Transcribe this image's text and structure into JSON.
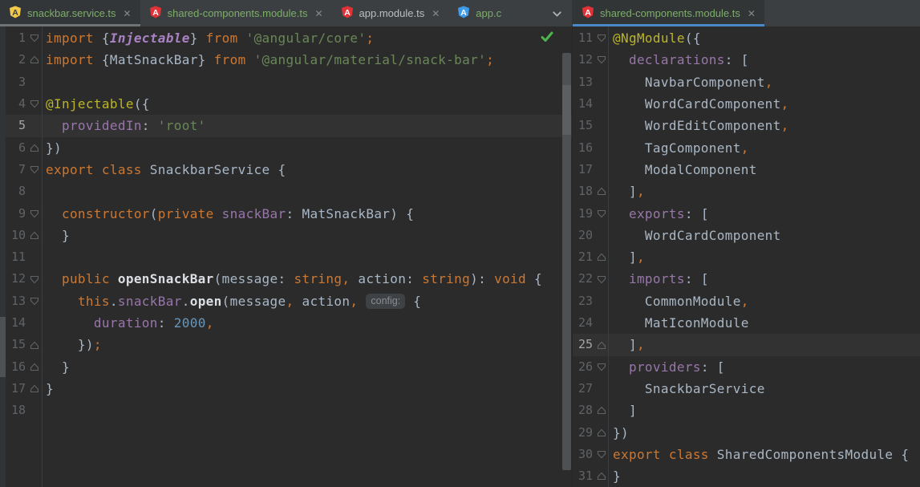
{
  "colors": {
    "active_tab_underline": "#4A88C7",
    "inactive_tab_underline": "#6E7376",
    "angular_red": "#E23237",
    "angular_yellow": "#F2C94C",
    "angular_blue": "#3D9BE9",
    "inspection_green": "#4DB54D",
    "editor_background": "#2B2B2B",
    "caret_row_background": "#323232"
  },
  "left_tab_bar": {
    "overflow_chevron_icon": "chevron-down-icon",
    "tabs": [
      {
        "label": "snackbar.service.ts",
        "icon": "angular-shield-yellow",
        "icon_color": "#F2C94C",
        "letter_color": "#3C3F41",
        "label_color": "#7CAE69",
        "selected": true,
        "active": false,
        "truncated": false
      },
      {
        "label": "shared-components.module.ts",
        "icon": "angular-shield-red",
        "icon_color": "#E23237",
        "letter_color": "#FFFFFF",
        "label_color": "#7CAE69",
        "selected": false,
        "active": false,
        "truncated": false
      },
      {
        "label": "app.module.ts",
        "icon": "angular-shield-red",
        "icon_color": "#E23237",
        "letter_color": "#FFFFFF",
        "label_color": "#BBBDBF",
        "selected": false,
        "active": false,
        "truncated": false
      },
      {
        "label": "app.c",
        "icon": "angular-shield-blue",
        "icon_color": "#3D9BE9",
        "letter_color": "#FFFFFF",
        "label_color": "#7CAE69",
        "selected": false,
        "active": false,
        "truncated": true
      }
    ]
  },
  "right_tab_bar": {
    "tabs": [
      {
        "label": "shared-components.module.ts",
        "icon": "angular-shield-red",
        "icon_color": "#E23237",
        "letter_color": "#FFFFFF",
        "label_color": "#7CAE69",
        "selected": true,
        "active": true,
        "truncated": false
      }
    ]
  },
  "left_editor": {
    "file": "snackbar.service.ts",
    "inspection_status": "ok-checkmark",
    "caret_line": 5,
    "lines": [
      {
        "n": 1,
        "fold": "down",
        "tokens": [
          [
            "k",
            "import "
          ],
          [
            "t",
            "{"
          ],
          [
            "pi",
            "Injectable"
          ],
          [
            "t",
            "} "
          ],
          [
            "k",
            "from "
          ],
          [
            "s",
            "'@angular/core'"
          ],
          [
            "p",
            ";"
          ]
        ]
      },
      {
        "n": 2,
        "fold": "up",
        "tokens": [
          [
            "k",
            "import "
          ],
          [
            "t",
            "{MatSnackBar} "
          ],
          [
            "k",
            "from "
          ],
          [
            "s",
            "'@angular/material/snack-bar'"
          ],
          [
            "p",
            ";"
          ]
        ]
      },
      {
        "n": 3,
        "fold": null,
        "tokens": []
      },
      {
        "n": 4,
        "fold": "down",
        "tokens": [
          [
            "d",
            "@Injectable"
          ],
          [
            "t",
            "({"
          ]
        ]
      },
      {
        "n": 5,
        "fold": null,
        "tokens": [
          [
            "t",
            "  "
          ],
          [
            "f",
            "providedIn"
          ],
          [
            "t",
            ": "
          ],
          [
            "s",
            "'root'"
          ]
        ]
      },
      {
        "n": 6,
        "fold": "up",
        "tokens": [
          [
            "t",
            "})"
          ]
        ]
      },
      {
        "n": 7,
        "fold": "down",
        "tokens": [
          [
            "k",
            "export class "
          ],
          [
            "t",
            "SnackbarService {"
          ]
        ]
      },
      {
        "n": 8,
        "fold": null,
        "tokens": []
      },
      {
        "n": 9,
        "fold": "down",
        "tokens": [
          [
            "t",
            "  "
          ],
          [
            "k",
            "constructor"
          ],
          [
            "t",
            "("
          ],
          [
            "k",
            "private "
          ],
          [
            "f",
            "snackBar"
          ],
          [
            "t",
            ": MatSnackBar) {"
          ]
        ]
      },
      {
        "n": 10,
        "fold": "up",
        "tokens": [
          [
            "t",
            "  }"
          ]
        ]
      },
      {
        "n": 11,
        "fold": null,
        "tokens": []
      },
      {
        "n": 12,
        "fold": "down",
        "tokens": [
          [
            "t",
            "  "
          ],
          [
            "k",
            "public "
          ],
          [
            "m",
            "openSnackBar"
          ],
          [
            "t",
            "(message: "
          ],
          [
            "k",
            "string"
          ],
          [
            "p",
            ","
          ],
          [
            "t",
            " action: "
          ],
          [
            "k",
            "string"
          ],
          [
            "t",
            "): "
          ],
          [
            "k",
            "void"
          ],
          [
            "t",
            " {"
          ]
        ]
      },
      {
        "n": 13,
        "fold": "down",
        "tokens": [
          [
            "t",
            "    "
          ],
          [
            "k",
            "this"
          ],
          [
            "t",
            "."
          ],
          [
            "f",
            "snackBar"
          ],
          [
            "t",
            "."
          ],
          [
            "m",
            "open"
          ],
          [
            "t",
            "(message"
          ],
          [
            "p",
            ","
          ],
          [
            "t",
            " action"
          ],
          [
            "p",
            ","
          ],
          [
            "t",
            " "
          ],
          [
            "i",
            "config:"
          ],
          [
            "t",
            " {"
          ]
        ]
      },
      {
        "n": 14,
        "fold": null,
        "tokens": [
          [
            "t",
            "      "
          ],
          [
            "f",
            "duration"
          ],
          [
            "t",
            ": "
          ],
          [
            "n",
            "2000"
          ],
          [
            "p",
            ","
          ]
        ]
      },
      {
        "n": 15,
        "fold": "up",
        "tokens": [
          [
            "t",
            "    })"
          ],
          [
            "p",
            ";"
          ]
        ]
      },
      {
        "n": 16,
        "fold": "up",
        "tokens": [
          [
            "t",
            "  }"
          ]
        ]
      },
      {
        "n": 17,
        "fold": "up",
        "tokens": [
          [
            "t",
            "}"
          ]
        ]
      },
      {
        "n": 18,
        "fold": null,
        "tokens": []
      }
    ]
  },
  "right_editor": {
    "file": "shared-components.module.ts",
    "caret_line": 25,
    "lines": [
      {
        "n": 11,
        "fold": "down",
        "tokens": [
          [
            "d",
            "@NgModule"
          ],
          [
            "t",
            "({"
          ]
        ]
      },
      {
        "n": 12,
        "fold": "down",
        "tokens": [
          [
            "t",
            "  "
          ],
          [
            "f",
            "declarations"
          ],
          [
            "t",
            ": ["
          ]
        ]
      },
      {
        "n": 13,
        "fold": null,
        "tokens": [
          [
            "t",
            "    NavbarComponent"
          ],
          [
            "p",
            ","
          ]
        ]
      },
      {
        "n": 14,
        "fold": null,
        "tokens": [
          [
            "t",
            "    WordCardComponent"
          ],
          [
            "p",
            ","
          ]
        ]
      },
      {
        "n": 15,
        "fold": null,
        "tokens": [
          [
            "t",
            "    WordEditComponent"
          ],
          [
            "p",
            ","
          ]
        ]
      },
      {
        "n": 16,
        "fold": null,
        "tokens": [
          [
            "t",
            "    TagComponent"
          ],
          [
            "p",
            ","
          ]
        ]
      },
      {
        "n": 17,
        "fold": null,
        "tokens": [
          [
            "t",
            "    ModalComponent"
          ]
        ]
      },
      {
        "n": 18,
        "fold": "up",
        "tokens": [
          [
            "t",
            "  ]"
          ],
          [
            "p",
            ","
          ]
        ]
      },
      {
        "n": 19,
        "fold": "down",
        "tokens": [
          [
            "t",
            "  "
          ],
          [
            "f",
            "exports"
          ],
          [
            "t",
            ": ["
          ]
        ]
      },
      {
        "n": 20,
        "fold": null,
        "tokens": [
          [
            "t",
            "    WordCardComponent"
          ]
        ]
      },
      {
        "n": 21,
        "fold": "up",
        "tokens": [
          [
            "t",
            "  ]"
          ],
          [
            "p",
            ","
          ]
        ]
      },
      {
        "n": 22,
        "fold": "down",
        "tokens": [
          [
            "t",
            "  "
          ],
          [
            "f",
            "imports"
          ],
          [
            "t",
            ": ["
          ]
        ]
      },
      {
        "n": 23,
        "fold": null,
        "tokens": [
          [
            "t",
            "    CommonModule"
          ],
          [
            "p",
            ","
          ]
        ]
      },
      {
        "n": 24,
        "fold": null,
        "tokens": [
          [
            "t",
            "    MatIconModule"
          ]
        ]
      },
      {
        "n": 25,
        "fold": "up",
        "tokens": [
          [
            "t",
            "  ]"
          ],
          [
            "p",
            ","
          ]
        ]
      },
      {
        "n": 26,
        "fold": "down",
        "tokens": [
          [
            "t",
            "  "
          ],
          [
            "f",
            "providers"
          ],
          [
            "t",
            ": ["
          ]
        ]
      },
      {
        "n": 27,
        "fold": null,
        "tokens": [
          [
            "t",
            "    SnackbarService"
          ]
        ]
      },
      {
        "n": 28,
        "fold": "up",
        "tokens": [
          [
            "t",
            "  ]"
          ]
        ]
      },
      {
        "n": 29,
        "fold": "up",
        "tokens": [
          [
            "t",
            "})"
          ]
        ]
      },
      {
        "n": 30,
        "fold": "down",
        "tokens": [
          [
            "k",
            "export class "
          ],
          [
            "t",
            "SharedComponentsModule {"
          ]
        ]
      },
      {
        "n": 31,
        "fold": "up",
        "tokens": [
          [
            "t",
            "}"
          ]
        ]
      }
    ]
  }
}
